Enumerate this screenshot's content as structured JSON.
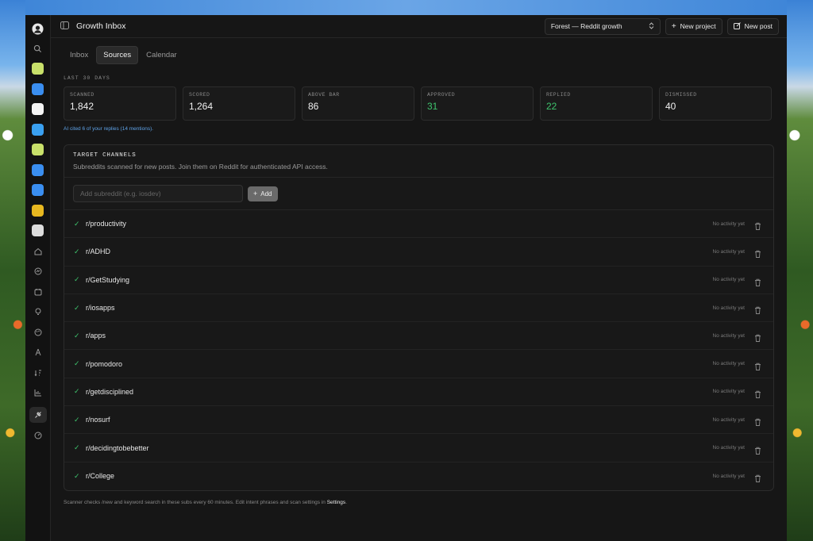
{
  "app": {
    "title": "Growth Inbox",
    "project_select": "Forest — Reddit growth",
    "new_project_label": "New project",
    "new_post_label": "New post"
  },
  "rail": {
    "apps": [
      {
        "icon": "app-lime-icon",
        "color": "#c8e06a"
      },
      {
        "icon": "app-blue-icon",
        "color": "#3a8ef0"
      },
      {
        "icon": "app-white-shape-icon",
        "color": "#f4f4f4"
      },
      {
        "icon": "app-chat-icon",
        "color": "#3aa0f0"
      },
      {
        "icon": "app-lime-2-icon",
        "color": "#c8e06a"
      },
      {
        "icon": "app-blue-2-icon",
        "color": "#3a8ef0"
      },
      {
        "icon": "app-blue-3-icon",
        "color": "#3a8ef0"
      },
      {
        "icon": "app-yellow-icon",
        "color": "#e8b820"
      },
      {
        "icon": "app-disk-icon",
        "color": "#dcdcdc"
      }
    ],
    "nav_icons": [
      "home-icon",
      "messages-icon",
      "calendar-icon",
      "bulb-icon",
      "palette-icon",
      "compass-icon",
      "sort-icon",
      "chart-icon",
      "sources-icon",
      "gauge-icon"
    ]
  },
  "tabs": [
    "Inbox",
    "Sources",
    "Calendar"
  ],
  "active_tab": "Sources",
  "period_label": "LAST 30 DAYS",
  "stats": [
    {
      "label": "SCANNED",
      "value": "1,842"
    },
    {
      "label": "SCORED",
      "value": "1,264"
    },
    {
      "label": "ABOVE BAR",
      "value": "86"
    },
    {
      "label": "APPROVED",
      "value": "31"
    },
    {
      "label": "REPLIED",
      "value": "22"
    },
    {
      "label": "DISMISSED",
      "value": "40"
    }
  ],
  "cited_note": "AI cited 6 of your replies (14 mentions).",
  "channels": {
    "title": "TARGET CHANNELS",
    "subtitle": "Subreddits scanned for new posts. Join them on Reddit for authenticated API access.",
    "input_placeholder": "Add subreddit (e.g. iosdev)",
    "add_label": "Add",
    "activity_label": "No activity yet",
    "list": [
      "r/productivity",
      "r/ADHD",
      "r/GetStudying",
      "r/iosapps",
      "r/apps",
      "r/pomodoro",
      "r/getdisciplined",
      "r/nosurf",
      "r/decidingtobebetter",
      "r/College"
    ]
  },
  "footnote": {
    "text": "Scanner checks /new and keyword search in these subs every 60 minutes. Edit intent phrases and scan settings in",
    "link": "Settings",
    "end": "."
  },
  "colors": {
    "accent_green": "#3ec46d",
    "link_blue": "#5fa3e8"
  }
}
